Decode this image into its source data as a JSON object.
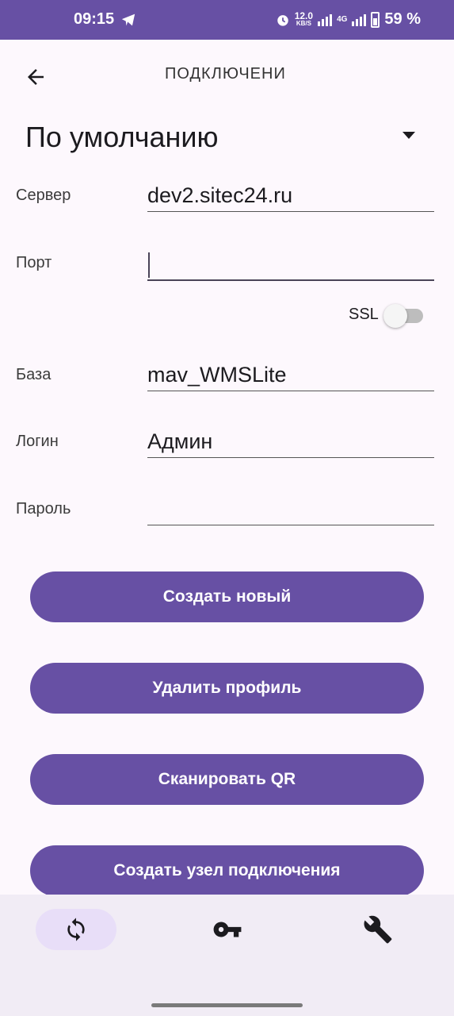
{
  "status_bar": {
    "time": "09:15",
    "net_speed_value": "12.0",
    "net_speed_unit": "KB/S",
    "network_type": "4G",
    "battery_percent": "59 %",
    "icons": [
      "telegram-icon",
      "alarm-icon",
      "signal-icon",
      "battery-icon"
    ]
  },
  "app_bar": {
    "title": "ПОДКЛЮЧЕНИ",
    "back_icon": "arrow-back-icon"
  },
  "profile": {
    "selected": "По умолчанию"
  },
  "form": {
    "server": {
      "label": "Сервер",
      "value": "dev2.sitec24.ru"
    },
    "port": {
      "label": "Порт",
      "value": ""
    },
    "ssl": {
      "label": "SSL",
      "checked": false
    },
    "database": {
      "label": "База",
      "value": "mav_WMSLite"
    },
    "login": {
      "label": "Логин",
      "value": "Админ"
    },
    "password": {
      "label": "Пароль",
      "value": ""
    }
  },
  "buttons": {
    "create_new": "Создать новый",
    "delete_profile": "Удалить профиль",
    "scan_qr": "Сканировать QR",
    "create_node": "Создать узел подключения"
  },
  "bottom_nav": {
    "items": [
      {
        "icon": "sync-icon",
        "active": true
      },
      {
        "icon": "key-icon",
        "active": false
      },
      {
        "icon": "wrench-icon",
        "active": false
      }
    ]
  },
  "colors": {
    "primary": "#6750a4",
    "background": "#fdf8fd",
    "nav_background": "#f1ecf5",
    "nav_active": "#e8def8"
  }
}
